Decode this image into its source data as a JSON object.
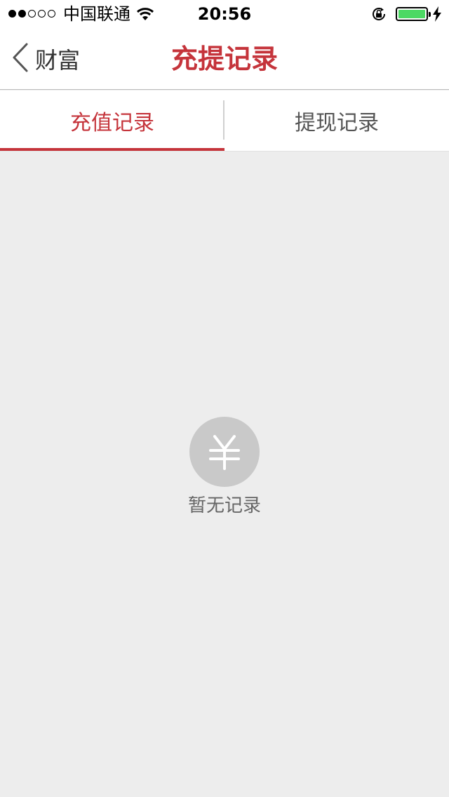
{
  "status_bar": {
    "carrier": "中国联通",
    "time": "20:56",
    "signal_bars_filled": 2,
    "signal_bars_total": 5,
    "battery_color": "#4cd964"
  },
  "nav": {
    "back_label": "财富",
    "title": "充提记录",
    "accent_color": "#c5343b"
  },
  "tabs": [
    {
      "label": "充值记录",
      "active": true
    },
    {
      "label": "提现记录",
      "active": false
    }
  ],
  "empty_state": {
    "icon": "yen-icon",
    "message": "暂无记录"
  }
}
